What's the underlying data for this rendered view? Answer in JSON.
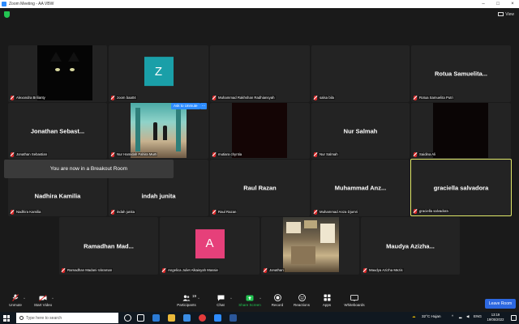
{
  "window": {
    "title": "Zoom Meeting - AA VBW"
  },
  "top": {
    "view_label": "View"
  },
  "tiles": [
    {
      "name": "Alexandra Brilianty"
    },
    {
      "name": "zoom baa04",
      "initial": "Z",
      "avatar_color": "#1a9fa8"
    },
    {
      "name": "Muhammad Rakhshan Radhiansyah"
    },
    {
      "name": "salsa bila"
    },
    {
      "display": "Rotua  Samuelita...",
      "name": "Rotua Samuelita Putri"
    },
    {
      "display": "Jonathan  Sebast...",
      "name": "Jonathan Sebastian"
    },
    {
      "name": "Nur Hamidah Fahira Murti"
    },
    {
      "name": "mutiara chyntia"
    },
    {
      "display": "Nur Salmah",
      "name": "Nur Salmah"
    },
    {
      "name": "Saidina Ali"
    },
    {
      "display": "Nadhira Kamilia",
      "name": "Nadhira Kamilia"
    },
    {
      "display": "indah junita",
      "name": "indah junita"
    },
    {
      "display": "Raul Razan",
      "name": "Raul Razan"
    },
    {
      "display": "Muhammad  Anz...",
      "name": "Muhammad Anza Djumri"
    },
    {
      "display": "graciella salvadora",
      "name": "graciella salvadora"
    },
    {
      "display": "Ramadhan  Mad...",
      "name": "Ramadhan Madani Ickraman"
    },
    {
      "name": "Angelica Juliet Alkaisyah Massie",
      "initial": "A",
      "avatar_color": "#e6407a"
    },
    {
      "name": "Jonathan"
    },
    {
      "display": "Maudya  Azizha...",
      "name": "Maudya Azizha Mezis"
    }
  ],
  "ask_unmute": {
    "label": "Ask to Unmute",
    "more": "..."
  },
  "breakout_toast": "You are now in a Breakout Room",
  "toolbar": {
    "unmute": "Unmute",
    "start_video": "Start Video",
    "participants": "Participants",
    "participants_count": "19",
    "chat": "Chat",
    "share_screen": "Share Screen",
    "record": "Record",
    "reactions": "Reactions",
    "apps": "Apps",
    "whiteboards": "Whiteboards",
    "leave": "Leave Room"
  },
  "taskbar": {
    "search_placeholder": "Type here to search",
    "weather": "32°C  Hujan",
    "lang": "ENG",
    "time": "13:19",
    "date": "19/05/2022"
  },
  "colors": {
    "accent": "#2d8cff",
    "active_speaker": "#e1e969",
    "leave": "#2d68e0",
    "muted": "#e02828",
    "secure": "#23c552"
  }
}
